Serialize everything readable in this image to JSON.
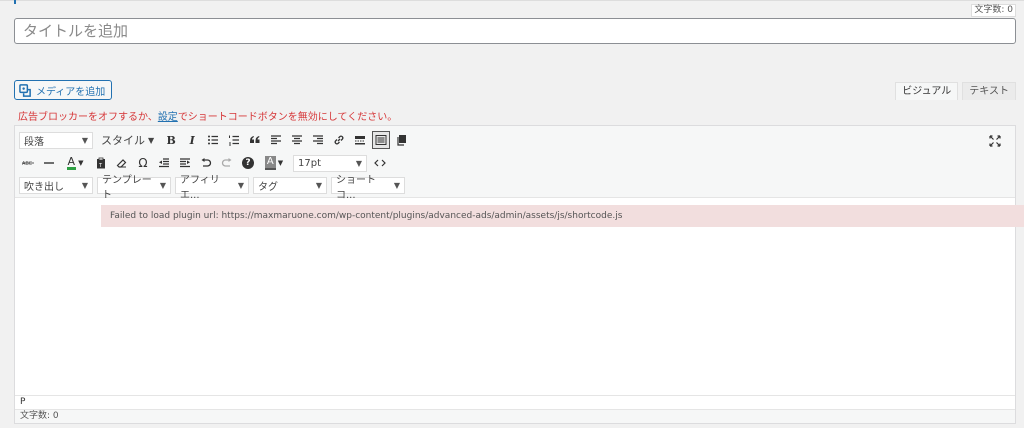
{
  "header": {
    "char_count": "文字数: 0"
  },
  "title": {
    "placeholder": "タイトルを追加"
  },
  "media_button": {
    "label": "メディアを追加"
  },
  "mode_tabs": {
    "visual": "ビジュアル",
    "text": "テキスト"
  },
  "notice": {
    "before": "広告ブロッカーをオフするか、",
    "link": "設定",
    "after": "でショートコードボタンを無効にしてください。"
  },
  "toolbar": {
    "paragraph_select": "段落",
    "style_dropdown": "スタイル",
    "font_size_select": "17pt",
    "balloon_select": "吹き出し",
    "template_select": "テンプレート",
    "affiliate_select": "アフィリエ...",
    "tag_select": "タグ",
    "shortcode_select": "ショートコ...",
    "bold": "B",
    "italic": "I",
    "omega": "Ω",
    "help": "?",
    "text_color": "A",
    "bg_color": "A"
  },
  "editor": {
    "error_message": "Failed to load plugin url: https://maxmaruone.com/wp-content/plugins/advanced-ads/admin/assets/js/shortcode.js",
    "path": "P",
    "status_char_count": "文字数: 0"
  },
  "colors": {
    "accent": "#2271b1",
    "error_text": "#d63638",
    "error_bg": "#f2dede",
    "text_color_underline": "#2ea043"
  }
}
